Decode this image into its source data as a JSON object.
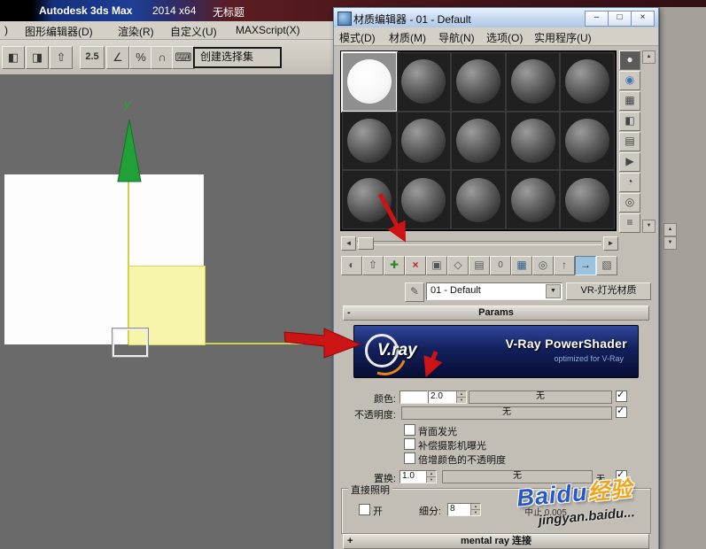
{
  "colors": {
    "arrow_red": "#cc1414",
    "banner_blue": "#13205c",
    "titlebar_blue": "#1d3f94",
    "titlebar_red": "#4a171b",
    "axis_green": "#2f9e3f",
    "scene_yellow": "#f7f5ab",
    "selected_tool_teal": "#9cc3de"
  },
  "glyphs": {
    "up": "▲",
    "down": "▼",
    "left": "◄",
    "right": "►",
    "dropdown": "▼",
    "check": "✓",
    "plus": "+",
    "minus": "-"
  },
  "app": {
    "titlebar": {
      "product": "Autodesk 3ds Max",
      "version": "2014 x64",
      "document": "无标题"
    },
    "menubar": {
      "cut_item": ")",
      "items": [
        "图形编辑器(D)",
        "渲染(R)",
        "自定义(U)",
        "MAXScript(X)"
      ]
    },
    "toolbar": {
      "icon1": "◧",
      "icon2": "◨",
      "icon3": "⇧",
      "snap": "2.5",
      "angle": "∠",
      "percent": "%",
      "magnet": "∩",
      "keyboard": "⌨",
      "selection_set": "创建选择集"
    },
    "viewport": {
      "axis_y": "y"
    }
  },
  "editor": {
    "title": "材质编辑器 - 01 - Default",
    "window_buttons": {
      "minimize": "–",
      "maximize": "□",
      "close": "×"
    },
    "menubar": [
      "模式(D)",
      "材质(M)",
      "导航(N)",
      "选项(O)",
      "实用程序(U)"
    ],
    "slots": {
      "rows": 3,
      "cols": 5,
      "selected_index": 1,
      "total": 15
    },
    "rail": [
      {
        "name": "sample-type-sphere",
        "glyph": "●"
      },
      {
        "name": "backlight",
        "glyph": "◉"
      },
      {
        "name": "background",
        "glyph": "▦"
      },
      {
        "name": "sample-uv-tiling",
        "glyph": "◧"
      },
      {
        "name": "video-color-check",
        "glyph": "▤"
      },
      {
        "name": "make-preview",
        "glyph": "▶"
      },
      {
        "name": "options",
        "glyph": "◔"
      },
      {
        "name": "select-by-material",
        "glyph": "◎"
      },
      {
        "name": "material-map-navigator",
        "glyph": "≡"
      }
    ],
    "tools": [
      {
        "name": "get-material",
        "glyph": "◐"
      },
      {
        "name": "put-to-scene",
        "glyph": "⇧"
      },
      {
        "name": "assign-to-selection",
        "glyph": "✚"
      },
      {
        "name": "reset-map",
        "glyph": "×"
      },
      {
        "name": "make-copy",
        "glyph": "▣"
      },
      {
        "name": "make-unique",
        "glyph": "◇"
      },
      {
        "name": "put-to-library",
        "glyph": "▤"
      },
      {
        "name": "material-id",
        "glyph": "0"
      },
      {
        "name": "show-in-viewport",
        "glyph": "▦"
      },
      {
        "name": "show-end-result",
        "glyph": "◎"
      },
      {
        "name": "go-to-parent",
        "glyph": "↑"
      },
      {
        "name": "go-forward-sibling",
        "glyph": "→",
        "pressed": true
      },
      {
        "name": "pick-sample",
        "glyph": "▧"
      }
    ],
    "pick_glyph": "✎",
    "material_name": "01 - Default",
    "material_type": "VR-灯光材质",
    "rollout_params": "Params",
    "banner": {
      "wordmark": "V.ray",
      "title": "V-Ray PowerShader",
      "tagline": "optimized for V-Ray"
    },
    "params": {
      "color_label": "颜色:",
      "color_value": "2.0",
      "color_map": "无",
      "color_checked": true,
      "opacity_label": "不透明度:",
      "opacity_map": "无",
      "opacity_checked": true,
      "options": [
        {
          "label": "背面发光",
          "checked": false
        },
        {
          "label": "补偿摄影机曝光",
          "checked": false
        },
        {
          "label": "倍增颜色的不透明度",
          "checked": false
        }
      ],
      "displace_label": "置换:",
      "displace_value": "1.0",
      "displace_map": "无",
      "displace_suffix": "无",
      "displace_checked": true
    },
    "direct": {
      "title": "直接照明",
      "on_label": "开",
      "on_checked": false,
      "subdivs_label": "细分:",
      "subdivs_value": "8",
      "cutoff": "中止 0.005"
    },
    "rollout_mental": "mental ray 连接"
  },
  "watermark": {
    "brand": "Baidu",
    "script": "经验",
    "url": "jingyan.baidu..."
  }
}
